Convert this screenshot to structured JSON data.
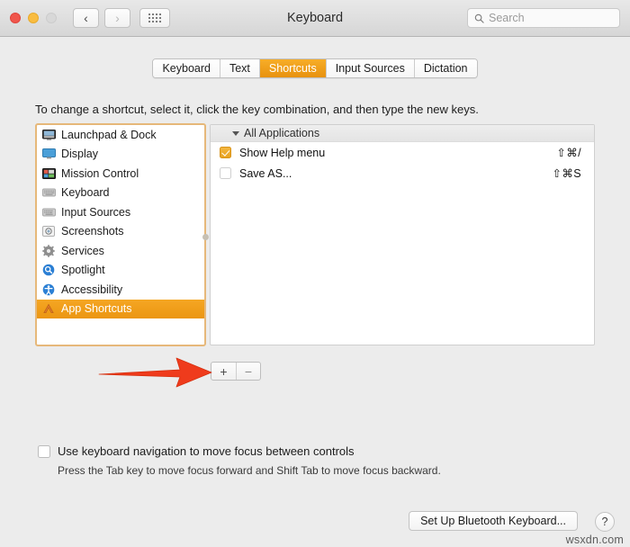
{
  "window": {
    "title": "Keyboard",
    "traffic_lights": [
      "close",
      "minimize",
      "zoom"
    ],
    "nav_back": "‹",
    "nav_forward": "›",
    "grid_icon": "show-all-icon"
  },
  "search": {
    "placeholder": "Search",
    "value": "",
    "icon": "search-icon"
  },
  "tabs": [
    {
      "label": "Keyboard",
      "active": false
    },
    {
      "label": "Text",
      "active": false
    },
    {
      "label": "Shortcuts",
      "active": true
    },
    {
      "label": "Input Sources",
      "active": false
    },
    {
      "label": "Dictation",
      "active": false
    }
  ],
  "main": {
    "instruction": "To change a shortcut, select it, click the key combination, and then type the new keys."
  },
  "categories": [
    {
      "label": "Launchpad & Dock",
      "icon": "launchpad-dock-icon",
      "selected": false
    },
    {
      "label": "Display",
      "icon": "display-icon",
      "selected": false
    },
    {
      "label": "Mission Control",
      "icon": "mission-control-icon",
      "selected": false
    },
    {
      "label": "Keyboard",
      "icon": "keyboard-icon",
      "selected": false
    },
    {
      "label": "Input Sources",
      "icon": "input-sources-icon",
      "selected": false
    },
    {
      "label": "Screenshots",
      "icon": "screenshots-icon",
      "selected": false
    },
    {
      "label": "Services",
      "icon": "services-gear-icon",
      "selected": false
    },
    {
      "label": "Spotlight",
      "icon": "spotlight-icon",
      "selected": false
    },
    {
      "label": "Accessibility",
      "icon": "accessibility-icon",
      "selected": false
    },
    {
      "label": "App Shortcuts",
      "icon": "app-shortcuts-icon",
      "selected": true
    }
  ],
  "shortcut_group": {
    "title": "All Applications",
    "expanded": true,
    "rows": [
      {
        "label": "Show Help menu",
        "keys": "⇧⌘/",
        "checked": true
      },
      {
        "label": "Save AS...",
        "keys": "⇧⌘S",
        "checked": false
      }
    ]
  },
  "addremove": {
    "add_label": "+",
    "remove_label": "−"
  },
  "annotation": {
    "arrow_color": "#ef3b1c",
    "points_to": "add-shortcut-button"
  },
  "keyboard_nav": {
    "label": "Use keyboard navigation to move focus between controls",
    "checked": false,
    "hint": "Press the Tab key to move focus forward and Shift Tab to move focus backward."
  },
  "footer": {
    "bluetooth_button": "Set Up Bluetooth Keyboard...",
    "help_button": "?",
    "watermark": "wsxdn.com"
  },
  "colors": {
    "accent_orange": "#eb9612",
    "tab_active_orange": "#f7ad28",
    "focus_ring": "#e6b87a",
    "window_bg": "#ececec",
    "arrow_red": "#ef3b1c"
  }
}
